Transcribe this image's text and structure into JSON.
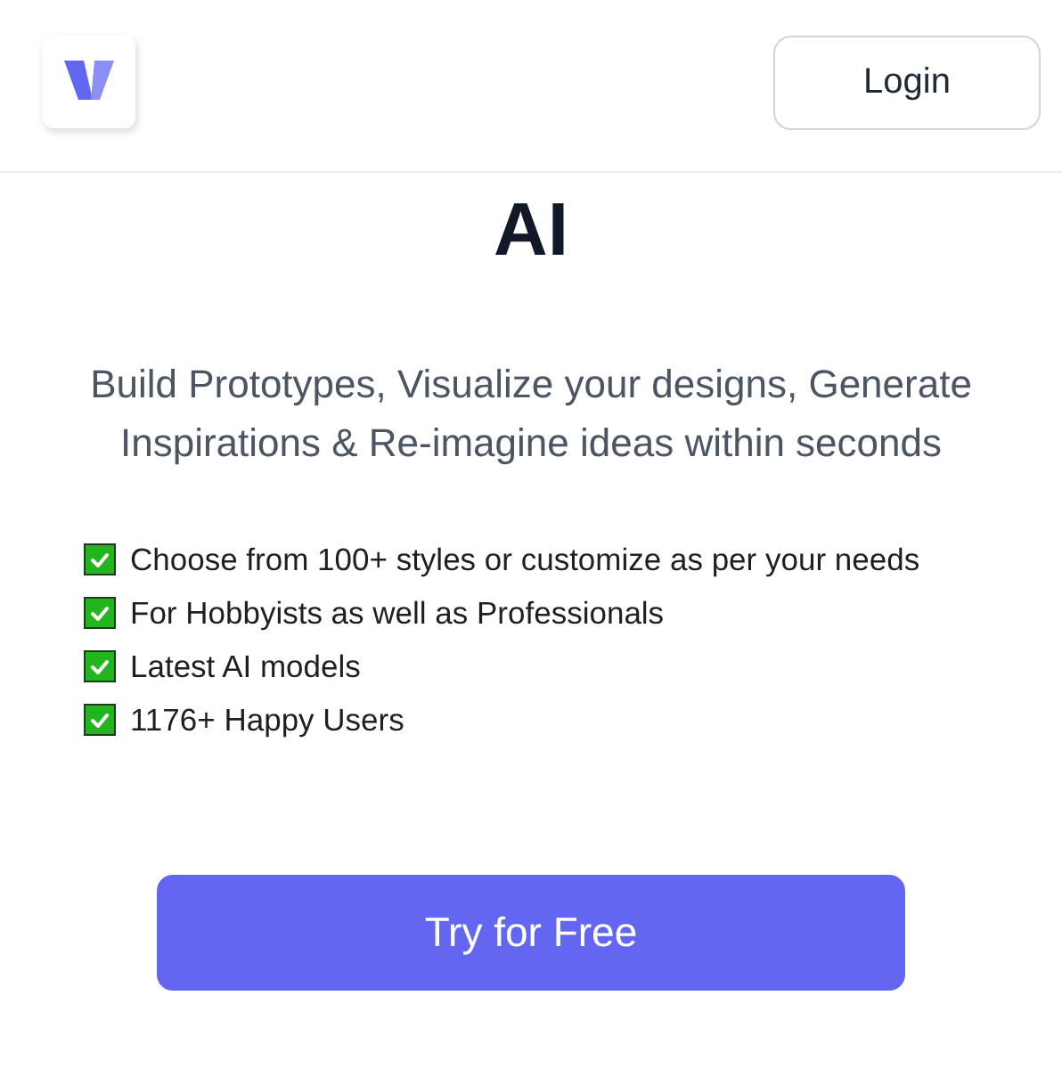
{
  "header": {
    "login_button": "Login"
  },
  "hero": {
    "title": "AI",
    "subtitle": "Build Prototypes, Visualize your designs, Generate Inspirations & Re-imagine ideas within seconds"
  },
  "features": [
    {
      "text": "Choose from 100+ styles or customize as per your needs",
      "checked": true
    },
    {
      "text": "For Hobbyists as well as Professionals",
      "checked": true
    },
    {
      "text": "Latest AI models",
      "checked": true
    },
    {
      "text": "1176+ Happy Users",
      "checked": true
    }
  ],
  "cta_button": "Try for Free"
}
